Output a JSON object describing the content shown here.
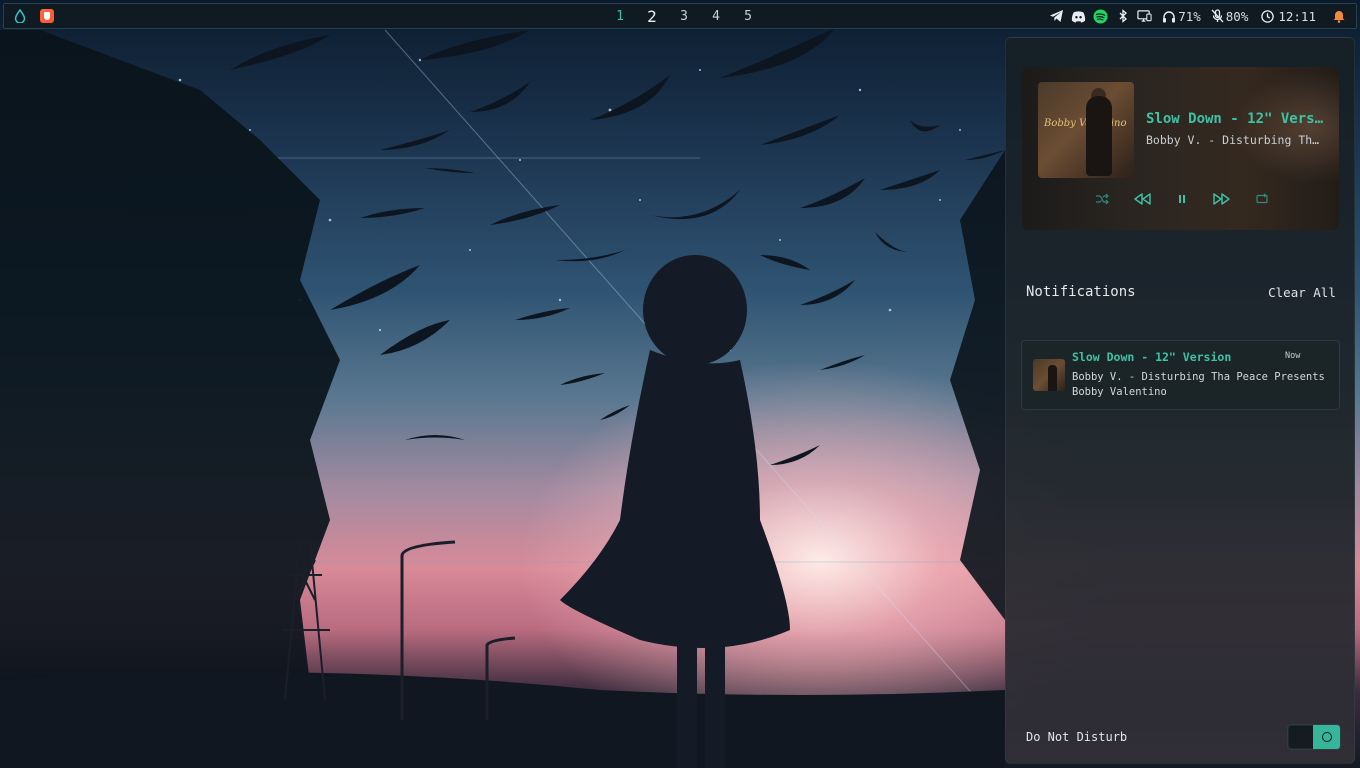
{
  "topbar": {
    "launcher_icon": "water-drop-icon",
    "browser_icon": "brave-browser-icon",
    "workspaces": [
      "1",
      "2",
      "3",
      "4",
      "5"
    ],
    "active_workspace": "1",
    "tray_icons": [
      "telegram-icon",
      "discord-icon",
      "spotify-icon",
      "bluetooth-icon",
      "network-icon"
    ],
    "headphones_volume": "71%",
    "mic_level": "80%",
    "clock": "12:11",
    "notification_icon": "bell-icon"
  },
  "player": {
    "title": "Slow Down - 12\" Version",
    "artist": "Bobby V. - Disturbing Tha Peace Presents Bobby Valentino",
    "album_art_text": "Bobby Valentino",
    "controls": [
      "shuffle-icon",
      "previous-icon",
      "pause-icon",
      "next-icon",
      "repeat-icon"
    ]
  },
  "notifications": {
    "header": "Notifications",
    "clear_label": "Clear All",
    "items": [
      {
        "title": "Slow Down - 12\" Version",
        "time": "Now",
        "body": "Bobby V. - Disturbing Tha Peace Presents Bobby Valentino"
      }
    ]
  },
  "dnd": {
    "label": "Do Not Disturb",
    "enabled": true
  },
  "colors": {
    "accent": "#3ec2a6",
    "toggle_on": "#37b59b",
    "bell": "#f08a3a",
    "spotify": "#1ed760"
  }
}
